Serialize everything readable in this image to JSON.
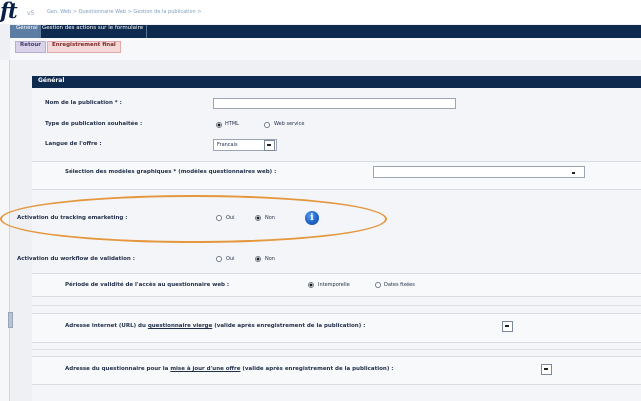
{
  "header": {
    "logo": "ft",
    "version": "v5",
    "breadcrumb": "Gen. Web > Questionnaire Web > Gestion de la publication >"
  },
  "nav": {
    "tabs": [
      {
        "label": "Général",
        "active": true
      },
      {
        "label": "Gestion des actions sur le formulaire",
        "active": false
      }
    ]
  },
  "toolbar": {
    "retour_label": "Retour",
    "final_label": "Enregistrement final"
  },
  "section": {
    "title": "Général"
  },
  "form": {
    "nom_label": "Nom de la publication * :",
    "nom_value": "",
    "type_label": "Type de publication souhaitée :",
    "type_options": [
      {
        "label": "HTML",
        "selected": true
      },
      {
        "label": "Web service",
        "selected": false
      }
    ],
    "langue_label": "Langue de l'offre :",
    "langue_value": "Francais",
    "modeles_label": "Sélection des modèles graphiques * (modèles questionnaires web) :",
    "modeles_value": "",
    "tracking_label": "Activation du tracking emarketing :",
    "tracking_options": [
      {
        "label": "Oui",
        "selected": false
      },
      {
        "label": "Non",
        "selected": true
      }
    ],
    "workflow_label": "Activation du workflow de validation :",
    "workflow_options": [
      {
        "label": "Oui",
        "selected": false
      },
      {
        "label": "Non",
        "selected": true
      }
    ],
    "periode_label": "Période de validité de l'accès au questionnaire web :",
    "periode_options": [
      {
        "label": "Intemporelle",
        "selected": true
      },
      {
        "label": "Dates fixées",
        "selected": false
      }
    ],
    "url_prefix": "Adresse internet (URL) du ",
    "url_link": "questionnaire vierge",
    "url_suffix": " (valide après enregistrement de la publication) :",
    "maj_prefix": "Adresse du questionnaire pour la ",
    "maj_link": "mise à jour d'une offre",
    "maj_suffix": " (valide après enregistrement de la publication) :"
  },
  "icons": {
    "info": "info-icon",
    "dropdown": "chevron-down-icon"
  },
  "colors": {
    "nav_bg": "#0f2a4f",
    "active_tab": "#5d7ea4",
    "highlight": "#e4973d",
    "info_icon": "#1f63c9"
  }
}
